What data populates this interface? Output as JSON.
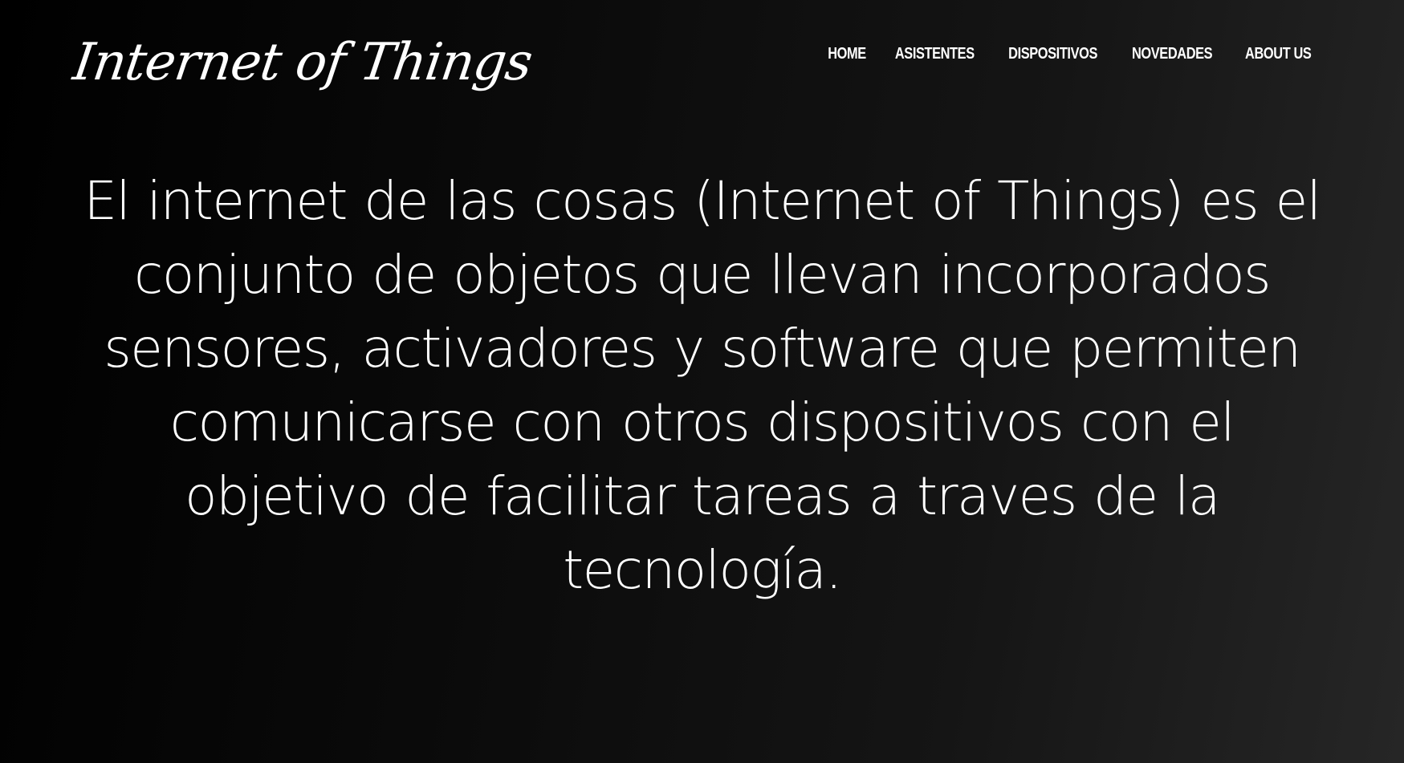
{
  "header": {
    "logo_text": "Internet of Things",
    "nav": [
      {
        "label": "HOME"
      },
      {
        "label": "ASISTENTES"
      },
      {
        "label": "DISPOSITIVOS"
      },
      {
        "label": "NOVEDADES"
      },
      {
        "label": "ABOUT US"
      }
    ]
  },
  "main": {
    "intro_text": "El internet de las cosas (Internet of Things) es el conjunto de objetos que llevan incorporados sensores, activadores y software que permiten comunicarse con otros dispositivos con el objetivo de facilitar tareas a traves de la tecnología."
  },
  "colors": {
    "background_start": "#000000",
    "background_end": "#262626",
    "text": "#ffffff"
  }
}
